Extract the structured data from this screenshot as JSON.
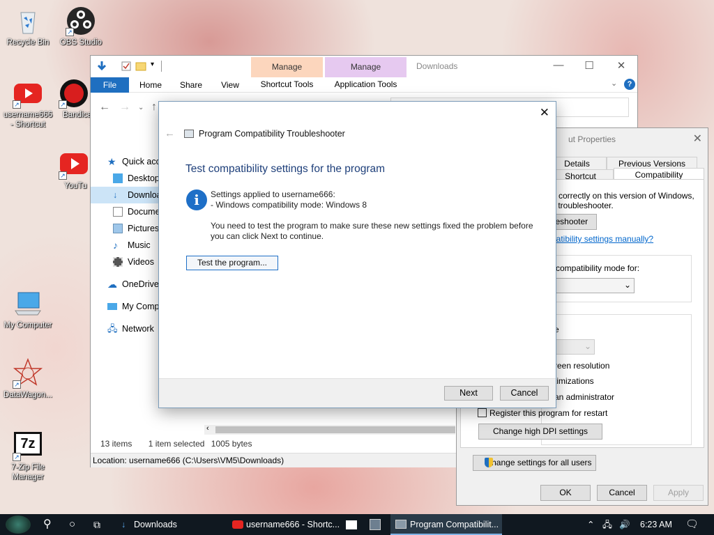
{
  "desktop": {
    "icons": [
      {
        "label_1": "Recycle Bin",
        "label_2": ""
      },
      {
        "label_1": "OBS Studio",
        "label_2": ""
      },
      {
        "label_1": "username666",
        "label_2": "- Shortcut"
      },
      {
        "label_1": "Bandica",
        "label_2": ""
      },
      {
        "label_1": "YouTu",
        "label_2": ""
      },
      {
        "label_1": "My Computer",
        "label_2": ""
      },
      {
        "label_1": "DataWagon...",
        "label_2": ""
      },
      {
        "label_1": "7-Zip File",
        "label_2": "Manager"
      }
    ],
    "sevenzip_logo_text": "7z"
  },
  "explorer": {
    "title": "Downloads",
    "manage1_top": "Manage",
    "manage1_bottom": "Shortcut Tools",
    "manage2_top": "Manage",
    "manage2_bottom": "Application Tools",
    "tabs": [
      "File",
      "Home",
      "Share",
      "View"
    ],
    "nav_items": [
      "Quick acc",
      "Desktop",
      "Downloa",
      "Docume",
      "Pictures",
      "Music",
      "Videos",
      "OneDrive",
      "My Comp",
      "Network"
    ],
    "status_count": "13 items",
    "status_selected": "1 item selected",
    "status_size": "1005 bytes",
    "location": "Location: username666 (C:\\Users\\VM5\\Downloads)",
    "colors": {
      "file_tab": "#1f6fc0",
      "manage1": "#fcd6bd",
      "manage2": "#e6c9f0",
      "selected": "#cce4f7"
    }
  },
  "properties": {
    "title": "ut Properties",
    "tabs": {
      "details": "Details",
      "previous_versions": "Previous Versions",
      "shortcut": "Shortcut",
      "compatibility": "Compatibility"
    },
    "text_running": "g correctly on this version of Windows,",
    "text_troubleshooter": "y troubleshooter.",
    "button_troubleshooter": "leshooter",
    "link_manual": "patibility settings manually?",
    "compat_mode_label": "compatibility mode for:",
    "settings_partial": "e",
    "opt_resolution": "reen resolution",
    "opt_optimizations": "timizations",
    "opt_admin": "an administrator",
    "opt_restart": "Register this program for restart",
    "btn_dpi": "Change high DPI settings",
    "btn_all_users": "Change settings for all users",
    "btn_ok": "OK",
    "btn_cancel": "Cancel",
    "btn_apply": "Apply"
  },
  "dialog": {
    "window_title": "Program Compatibility Troubleshooter",
    "heading": "Test compatibility settings for the program",
    "applied_line": "Settings applied to username666:",
    "mode_line": "- Windows compatibility mode: Windows 8",
    "instruction_line1": "You need to test the program to make sure these new settings fixed the problem before",
    "instruction_line2": "you can click Next to continue.",
    "test_button": "Test the program...",
    "next_button": "Next",
    "cancel_button": "Cancel",
    "colors": {
      "heading": "#1e3f7a",
      "info": "#1e6fc7"
    }
  },
  "taskbar": {
    "item_downloads": "Downloads",
    "item_shortcut": "username666 - Shortc...",
    "item_troubleshooter": "Program Compatibilit...",
    "clock": "6:23 AM"
  }
}
